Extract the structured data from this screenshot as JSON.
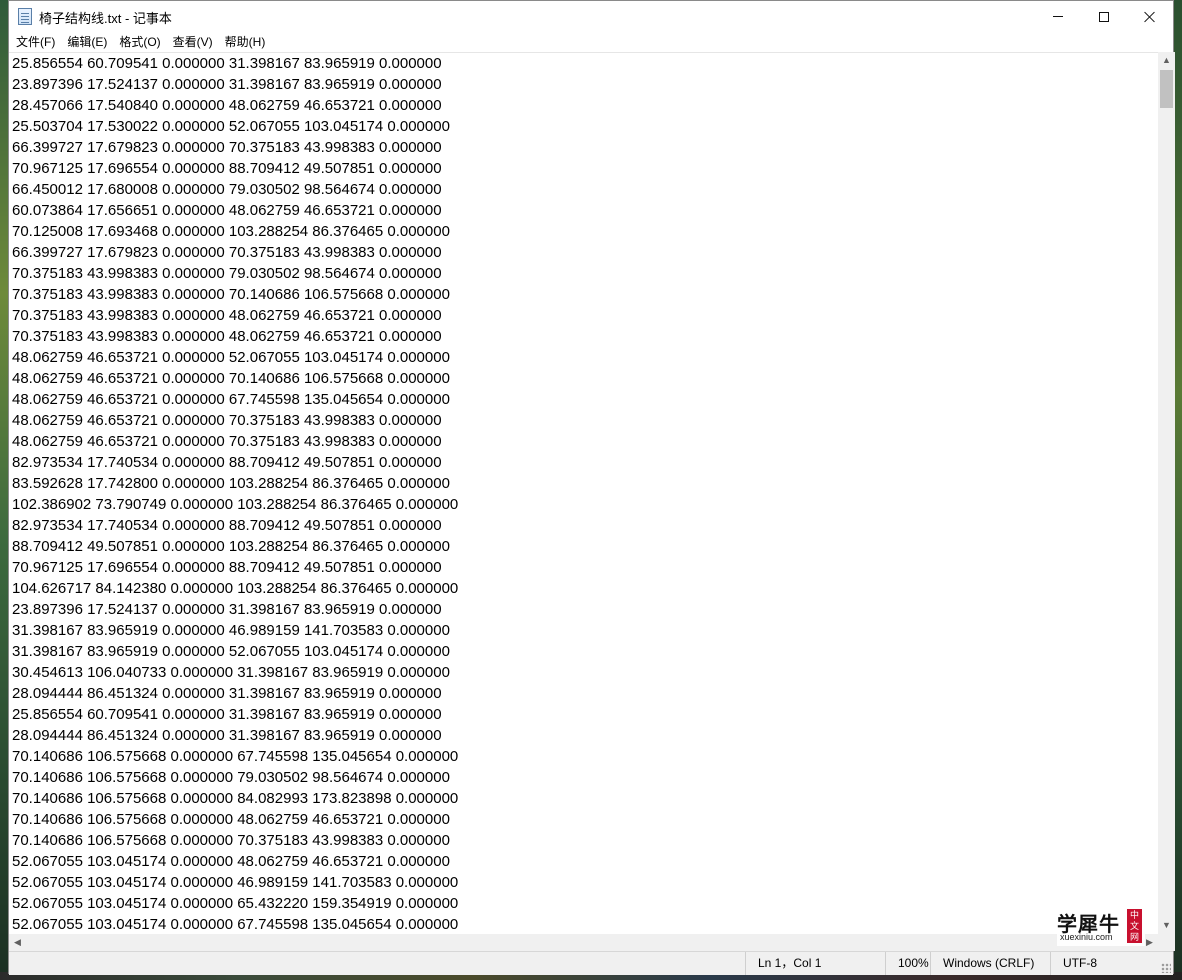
{
  "window": {
    "title": "椅子结构线.txt - 记事本",
    "app_icon": "notepad-icon"
  },
  "menu": [
    "文件(F)",
    "编辑(E)",
    "格式(O)",
    "查看(V)",
    "帮助(H)"
  ],
  "content_lines": [
    "25.856554 60.709541 0.000000 31.398167 83.965919 0.000000",
    "23.897396 17.524137 0.000000 31.398167 83.965919 0.000000",
    "28.457066 17.540840 0.000000 48.062759 46.653721 0.000000",
    "25.503704 17.530022 0.000000 52.067055 103.045174 0.000000",
    "66.399727 17.679823 0.000000 70.375183 43.998383 0.000000",
    "70.967125 17.696554 0.000000 88.709412 49.507851 0.000000",
    "66.450012 17.680008 0.000000 79.030502 98.564674 0.000000",
    "60.073864 17.656651 0.000000 48.062759 46.653721 0.000000",
    "70.125008 17.693468 0.000000 103.288254 86.376465 0.000000",
    "66.399727 17.679823 0.000000 70.375183 43.998383 0.000000",
    "70.375183 43.998383 0.000000 79.030502 98.564674 0.000000",
    "70.375183 43.998383 0.000000 70.140686 106.575668 0.000000",
    "70.375183 43.998383 0.000000 48.062759 46.653721 0.000000",
    "70.375183 43.998383 0.000000 48.062759 46.653721 0.000000",
    "48.062759 46.653721 0.000000 52.067055 103.045174 0.000000",
    "48.062759 46.653721 0.000000 70.140686 106.575668 0.000000",
    "48.062759 46.653721 0.000000 67.745598 135.045654 0.000000",
    "48.062759 46.653721 0.000000 70.375183 43.998383 0.000000",
    "48.062759 46.653721 0.000000 70.375183 43.998383 0.000000",
    "82.973534 17.740534 0.000000 88.709412 49.507851 0.000000",
    "83.592628 17.742800 0.000000 103.288254 86.376465 0.000000",
    "102.386902 73.790749 0.000000 103.288254 86.376465 0.000000",
    "82.973534 17.740534 0.000000 88.709412 49.507851 0.000000",
    "88.709412 49.507851 0.000000 103.288254 86.376465 0.000000",
    "70.967125 17.696554 0.000000 88.709412 49.507851 0.000000",
    "104.626717 84.142380 0.000000 103.288254 86.376465 0.000000",
    "23.897396 17.524137 0.000000 31.398167 83.965919 0.000000",
    "31.398167 83.965919 0.000000 46.989159 141.703583 0.000000",
    "31.398167 83.965919 0.000000 52.067055 103.045174 0.000000",
    "30.454613 106.040733 0.000000 31.398167 83.965919 0.000000",
    "28.094444 86.451324 0.000000 31.398167 83.965919 0.000000",
    "25.856554 60.709541 0.000000 31.398167 83.965919 0.000000",
    "28.094444 86.451324 0.000000 31.398167 83.965919 0.000000",
    "70.140686 106.575668 0.000000 67.745598 135.045654 0.000000",
    "70.140686 106.575668 0.000000 79.030502 98.564674 0.000000",
    "70.140686 106.575668 0.000000 84.082993 173.823898 0.000000",
    "70.140686 106.575668 0.000000 48.062759 46.653721 0.000000",
    "70.140686 106.575668 0.000000 70.375183 43.998383 0.000000",
    "52.067055 103.045174 0.000000 48.062759 46.653721 0.000000",
    "52.067055 103.045174 0.000000 46.989159 141.703583 0.000000",
    "52.067055 103.045174 0.000000 65.432220 159.354919 0.000000",
    "52.067055 103.045174 0.000000 67.745598 135.045654 0.000000"
  ],
  "status": {
    "position": "Ln 1，Col 1",
    "zoom": "100%",
    "line_ending": "Windows (CRLF)",
    "encoding": "UTF-8"
  },
  "watermark": {
    "text": "学犀牛",
    "sub": "xuexiniu.com",
    "badge": "中文网"
  }
}
